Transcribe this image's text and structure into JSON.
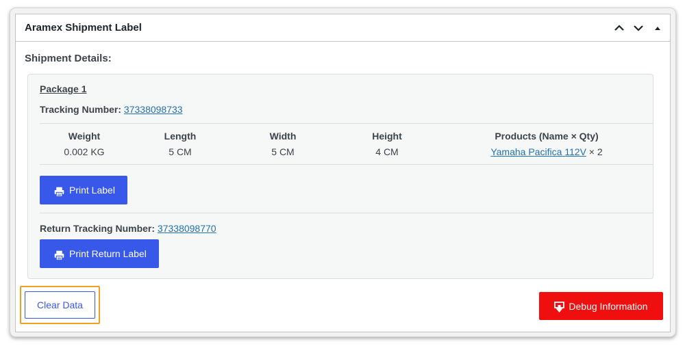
{
  "panel": {
    "title": "Aramex Shipment Label",
    "section_heading": "Shipment Details:"
  },
  "package": {
    "title": "Package 1",
    "tracking_label": "Tracking Number:",
    "tracking_number": "37338098733",
    "table": {
      "headers": [
        "Weight",
        "Length",
        "Width",
        "Height",
        "Products (Name × Qty)"
      ],
      "row": {
        "weight": "0.002 KG",
        "length": "5 CM",
        "width": "5 CM",
        "height": "4 CM",
        "product_name": "Yamaha Pacifica 112V",
        "product_qty": "× 2"
      }
    },
    "print_label": "Print Label",
    "return_tracking_label": "Return Tracking Number:",
    "return_tracking_number": "37338098770",
    "print_return_label": "Print Return Label"
  },
  "actions": {
    "clear_data": "Clear Data",
    "debug_information": "Debug Information"
  },
  "icons": {
    "move_up": "chevron-up-icon",
    "move_down": "chevron-down-icon",
    "toggle": "triangle-up-icon",
    "print": "printer-icon",
    "debug": "download-icon"
  },
  "colors": {
    "primary": "#3858e9",
    "danger": "#f00f0f",
    "link": "#2271b1",
    "highlight": "#f0a020"
  }
}
